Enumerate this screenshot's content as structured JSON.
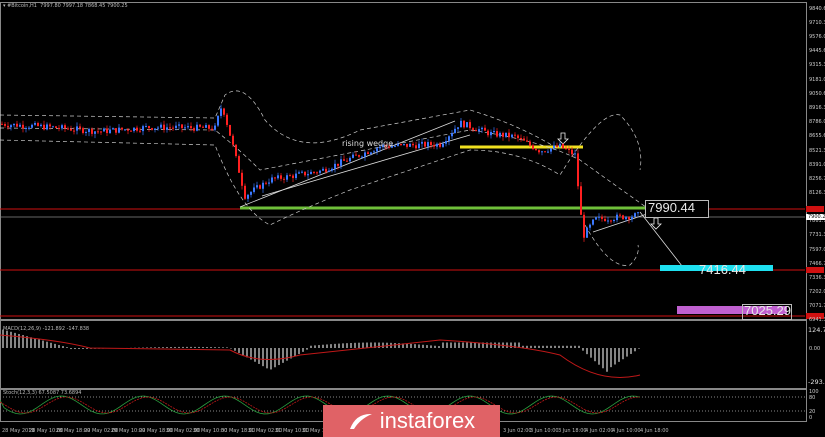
{
  "header": {
    "symbol": "#Bitcoin,H1",
    "ohlc": "7997.80 7997.18 7868.45 7900.25"
  },
  "price_axis": [
    {
      "label": "9840.65",
      "p": 9840.65
    },
    {
      "label": "9710.30",
      "p": 9710.3
    },
    {
      "label": "9576.00",
      "p": 9576.0
    },
    {
      "label": "9445.65",
      "p": 9445.65
    },
    {
      "label": "9315.30",
      "p": 9315.3
    },
    {
      "label": "9181.00",
      "p": 9181.0
    },
    {
      "label": "9050.65",
      "p": 9050.65
    },
    {
      "label": "8916.35",
      "p": 8916.35
    },
    {
      "label": "8786.00",
      "p": 8786.0
    },
    {
      "label": "8655.65",
      "p": 8655.65
    },
    {
      "label": "8521.35",
      "p": 8521.35
    },
    {
      "label": "8391.00",
      "p": 8391.0
    },
    {
      "label": "8256.70",
      "p": 8256.7
    },
    {
      "label": "8126.35",
      "p": 8126.35
    },
    {
      "label": "7861.70",
      "p": 7861.7
    },
    {
      "label": "7731.35",
      "p": 7731.35
    },
    {
      "label": "7597.05",
      "p": 7597.05
    },
    {
      "label": "7466.70",
      "p": 7466.7
    },
    {
      "label": "7336.35",
      "p": 7336.35
    },
    {
      "label": "7202.05",
      "p": 7202.05
    },
    {
      "label": "7071.70",
      "p": 7071.7
    },
    {
      "label": "6941.35",
      "p": 6941.35
    }
  ],
  "current_price": {
    "label": "7900.25",
    "p": 7900.25
  },
  "levels": {
    "resistance": "7990.44",
    "target1": "7416.44",
    "target2": "7025.29",
    "colors": {
      "green": "#6fbf3a",
      "yellow": "#f0e020",
      "cyan": "#1ee0f0",
      "purple": "#c060d0",
      "red": "#d01010"
    }
  },
  "annotations": {
    "wedge": "rising wedge"
  },
  "macd": {
    "label": "MACD(12,26,9) -121.892 -147.838",
    "scale_top": "124.737",
    "zero": "0.00",
    "scale_bottom": "-293.262"
  },
  "stoch": {
    "label": "Stoch(12,3,3) 67.5087 73.6894",
    "levels": [
      "100",
      "80",
      "20",
      "0"
    ]
  },
  "time_axis": [
    "28 May 2019",
    "28 May 10:00",
    "28 May 18:00",
    "29 May 02:00",
    "29 May 10:00",
    "29 May 18:00",
    "30 May 02:00",
    "30 May 10:00",
    "30 May 18:00",
    "31 May 02:00",
    "31 May 10:00",
    "31 May 18:00",
    "3 Jun 02:00",
    "3 Jun 10:00",
    "3 Jun 18:00",
    "4 Jun 02:00",
    "4 Jun 10:00",
    "4 Jun 18:00"
  ],
  "price_path": [
    [
      0,
      8770
    ],
    [
      50,
      8740
    ],
    [
      100,
      8700
    ],
    [
      150,
      8740
    ],
    [
      215,
      8730
    ],
    [
      222,
      8950
    ],
    [
      232,
      8600
    ],
    [
      245,
      8100
    ],
    [
      270,
      8250
    ],
    [
      320,
      8330
    ],
    [
      380,
      8560
    ],
    [
      440,
      8580
    ],
    [
      460,
      8780
    ],
    [
      490,
      8680
    ],
    [
      515,
      8650
    ],
    [
      540,
      8520
    ],
    [
      560,
      8560
    ],
    [
      575,
      8480
    ],
    [
      583,
      7720
    ],
    [
      595,
      7880
    ],
    [
      640,
      7920
    ]
  ],
  "logo": {
    "text": "instaforex"
  }
}
